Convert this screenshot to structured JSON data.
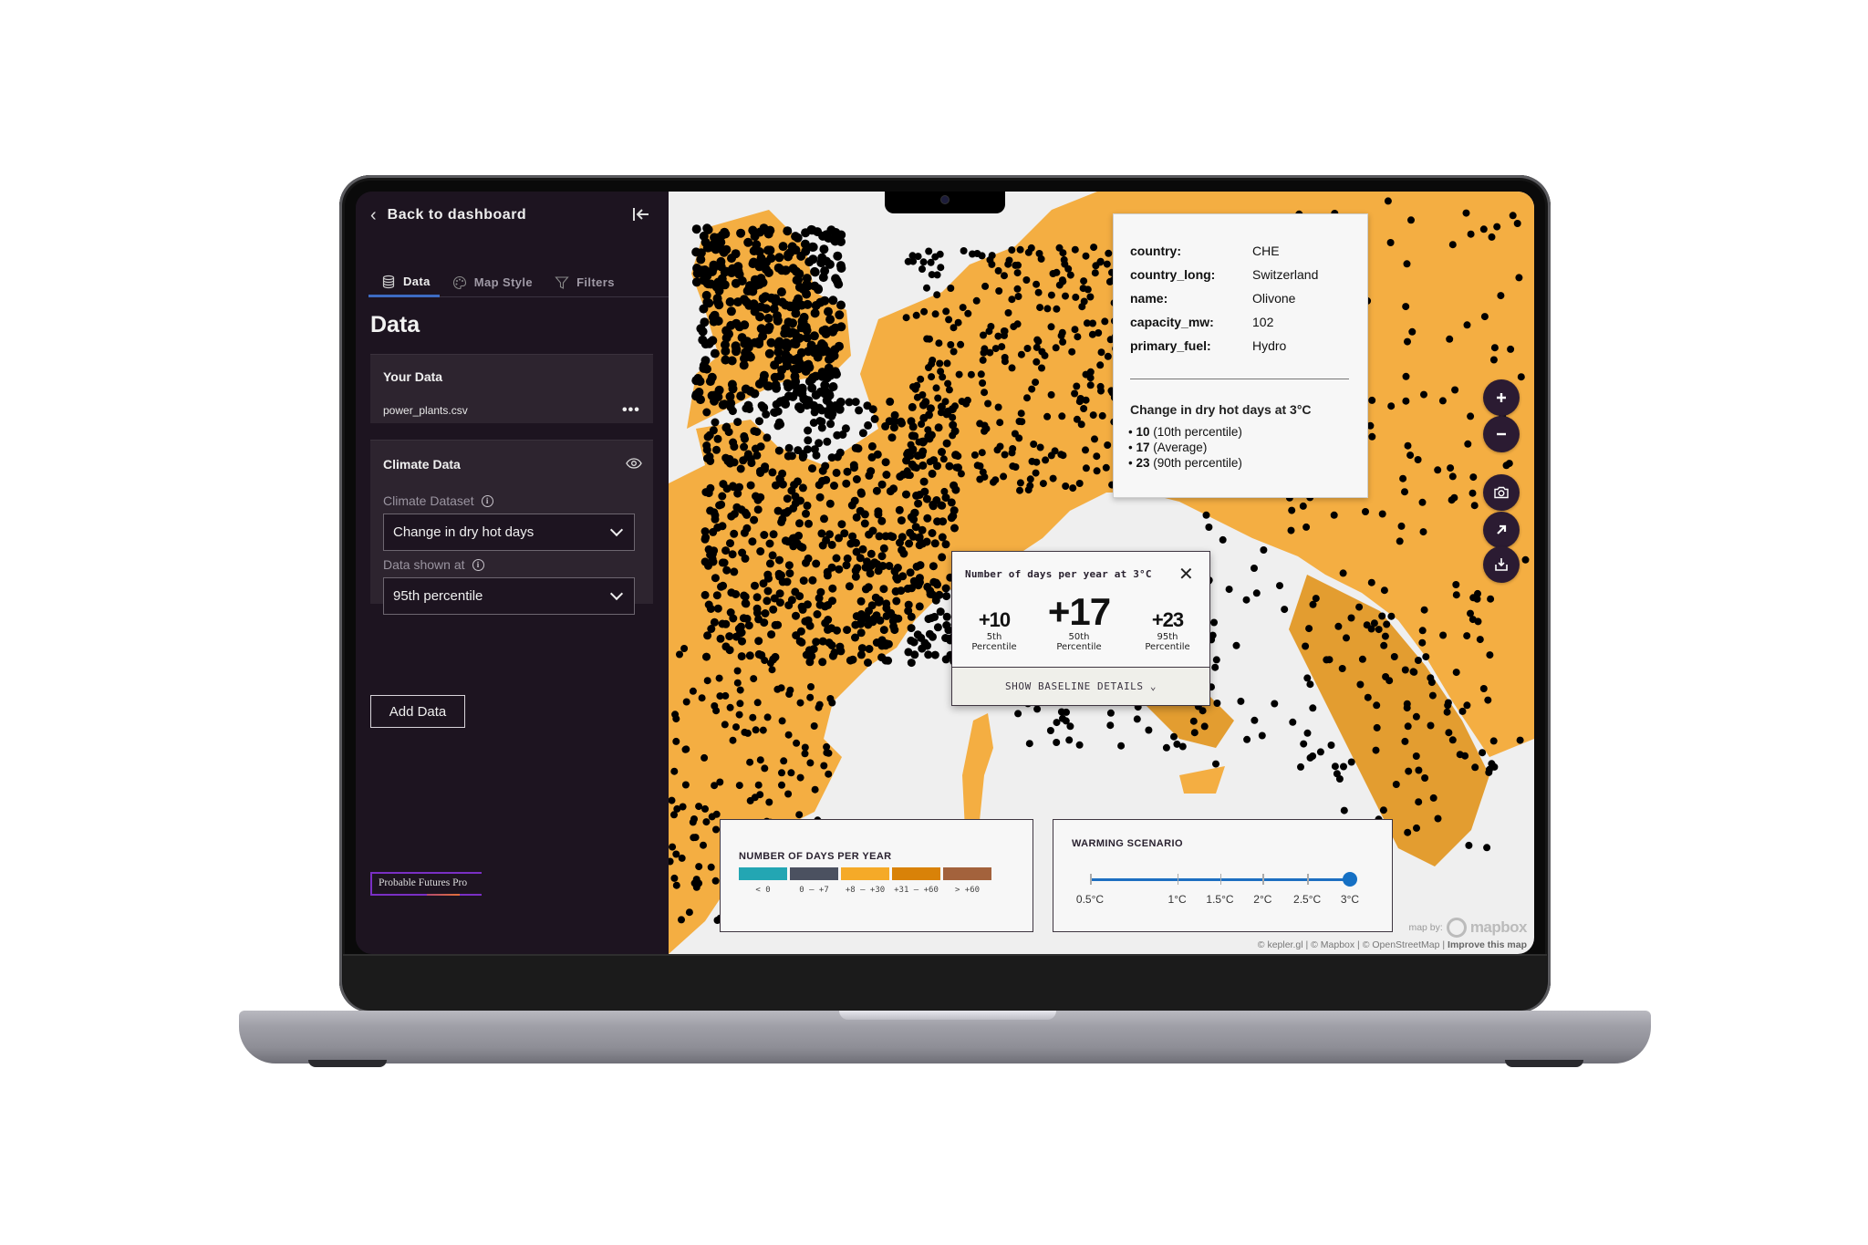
{
  "sidebar": {
    "back_label": "Back to dashboard",
    "tabs": [
      {
        "label": "Data",
        "icon": "database-icon",
        "active": true
      },
      {
        "label": "Map Style",
        "icon": "palette-icon",
        "active": false
      },
      {
        "label": "Filters",
        "icon": "filter-icon",
        "active": false
      }
    ],
    "panel_title": "Data",
    "your_data": {
      "title": "Your Data",
      "file_name": "power_plants.csv",
      "more_label": "•••"
    },
    "climate_data": {
      "title": "Climate Data",
      "dataset_label": "Climate Dataset",
      "dataset_value": "Change in dry hot days",
      "shown_at_label": "Data shown at",
      "shown_at_value": "95th percentile"
    },
    "add_data_label": "Add Data",
    "brand": "Probable Futures Pro"
  },
  "map": {
    "land_color": "#f4ae42",
    "land_darker_color": "#e39d30",
    "water_color": "#efefef",
    "point_color": "#000000",
    "tooltip": {
      "fields": [
        {
          "key": "country:",
          "value": "CHE"
        },
        {
          "key": "country_long:",
          "value": "Switzerland"
        },
        {
          "key": "name:",
          "value": "Olivone"
        },
        {
          "key": "capacity_mw:",
          "value": "102"
        },
        {
          "key": "primary_fuel:",
          "value": "Hydro"
        }
      ],
      "subtitle": "Change in dry hot days at 3°C",
      "list": [
        {
          "value": "10",
          "label": "(10th percentile)"
        },
        {
          "value": "17",
          "label": "(Average)"
        },
        {
          "value": "23",
          "label": "(90th percentile)"
        }
      ]
    },
    "popup": {
      "title": "Number of days per year at 3°C",
      "values": [
        {
          "value": "+10",
          "label_line1": "5th",
          "label_line2": "Percentile"
        },
        {
          "value": "+17",
          "label_line1": "50th",
          "label_line2": "Percentile"
        },
        {
          "value": "+23",
          "label_line1": "95th",
          "label_line2": "Percentile"
        }
      ],
      "baseline_label": "SHOW BASELINE DETAILS ⌄"
    },
    "controls": [
      {
        "name": "zoom-in",
        "icon": "plus-icon"
      },
      {
        "name": "zoom-out",
        "icon": "minus-icon"
      },
      {
        "name": "screenshot",
        "icon": "camera-icon"
      },
      {
        "name": "share",
        "icon": "arrow-up-right-icon"
      },
      {
        "name": "download",
        "icon": "download-icon"
      }
    ],
    "legend_days": {
      "title": "NUMBER OF DAYS PER YEAR",
      "bins": [
        {
          "label": "< 0",
          "color": "#23a6b3"
        },
        {
          "label": "0 – +7",
          "color": "#4b5160"
        },
        {
          "label": "+8 – +30",
          "color": "#f5aa28"
        },
        {
          "label": "+31 – +60",
          "color": "#d98208"
        },
        {
          "label": "> +60",
          "color": "#a3623c"
        }
      ]
    },
    "legend_warming": {
      "title": "WARMING SCENARIO",
      "stops": [
        "0.5°C",
        "1°C",
        "1.5°C",
        "2°C",
        "2.5°C",
        "3°C"
      ],
      "selected": "3°C",
      "accent": "#1570c4"
    },
    "map_by": "map by:",
    "mapbox_logo": "mapbox",
    "attribution": "© kepler.gl | © Mapbox | © OpenStreetMap |",
    "improve_link": "Improve this map"
  }
}
